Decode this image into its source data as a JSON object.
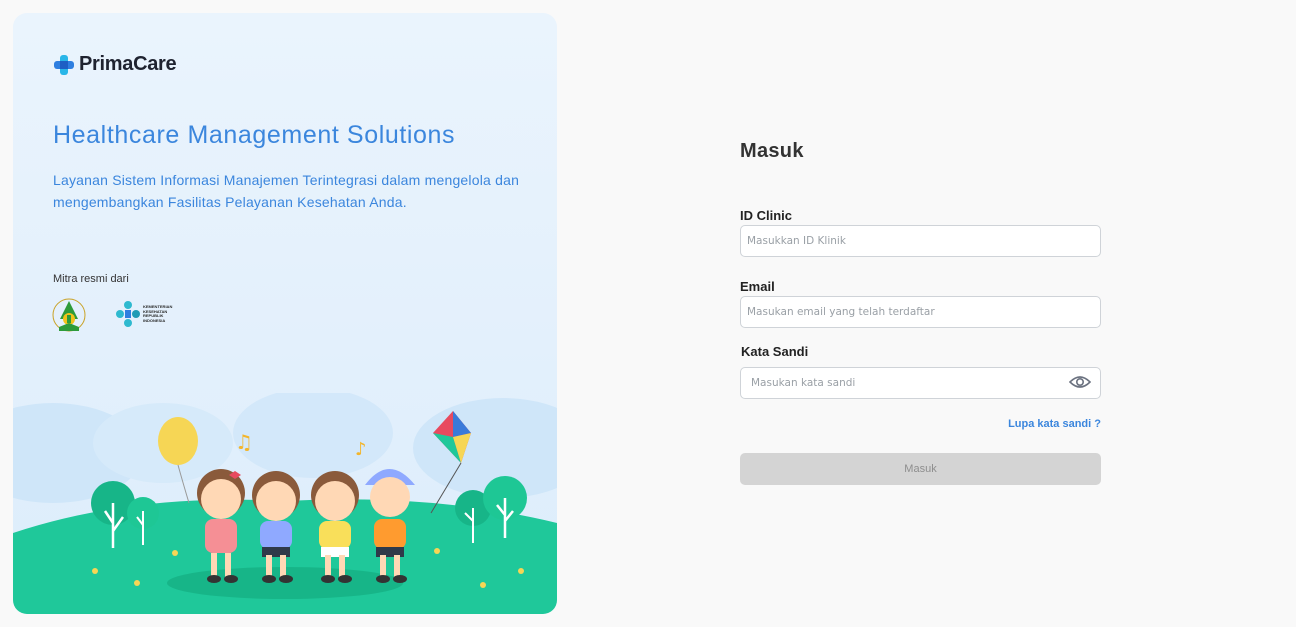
{
  "brand": {
    "name": "PrimaCare"
  },
  "hero": {
    "title": "Healthcare Management Solutions",
    "subtitle": "Layanan Sistem Informasi Manajemen Terintegrasi dalam mengelola dan mengembangkan Fasilitas Pelayanan Kesehatan Anda.",
    "partners_label": "Mitra resmi dari",
    "kemkes_text": "KEMENTERIAN KESEHATAN REPUBLIK INDONESIA"
  },
  "login": {
    "title": "Masuk",
    "clinic_label": "ID Clinic",
    "clinic_placeholder": "Masukkan ID Klinik",
    "clinic_value": "",
    "email_label": "Email",
    "email_placeholder": "Masukan email yang telah terdaftar",
    "email_value": "",
    "password_label": "Kata Sandi",
    "password_placeholder": "Masukan kata sandi",
    "password_value": "",
    "forgot_label": "Lupa kata sandi ?",
    "submit_label": "Masuk"
  },
  "colors": {
    "accent": "#3b86dd",
    "brand_cyan": "#29b6e8",
    "hero_bg": "#eaf4fd",
    "grass": "#1fc89a",
    "button_disabled": "#d4d4d4"
  },
  "icons": {
    "brand": "medical-cross-logo",
    "password_toggle": "eye-icon"
  }
}
